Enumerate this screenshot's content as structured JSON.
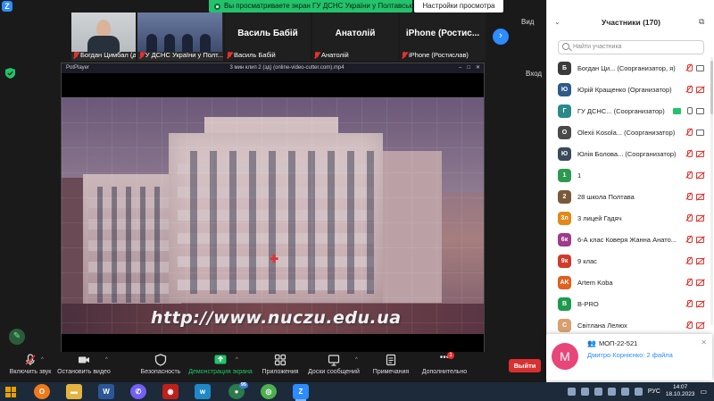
{
  "window": {
    "share_banner": "Вы просматриваете экран ГУ ДСНС України у Полтавській ...",
    "view_settings": "Настройки просмотра",
    "view_label": "Вид",
    "enter_label": "Вход"
  },
  "thumbnails": [
    {
      "name": "Богдан Цимбал (доц...",
      "type": "video"
    },
    {
      "name": "ГУ ДСНС України у Полт...",
      "type": "video"
    },
    {
      "big": "Василь Бабій",
      "name": "Василь Бабій",
      "type": "name"
    },
    {
      "big": "Анатолій",
      "name": "Анатолій",
      "type": "name"
    },
    {
      "big": "iPhone (Ростис...",
      "name": "iPhone (Ростислав)",
      "type": "name"
    }
  ],
  "player": {
    "app": "PotPlayer",
    "file": "3 мин клип 2 (зд) (online-video-cutter.com).mp4",
    "url_overlay": "http://www.nuczu.edu.ua"
  },
  "toolbar": {
    "unmute": "Включить звук",
    "stop_video": "Остановить видео",
    "security": "Безопасность",
    "screen_demo": "Демонстрация экрана",
    "apps": "Приложения",
    "messages": "Доски сообщений",
    "notes": "Примечания",
    "more": "Дополнительно",
    "more_badge": "1",
    "leave": "Выйти"
  },
  "panel": {
    "title": "Участники (170)",
    "search_placeholder": "Найти участника"
  },
  "participants": [
    {
      "initial": "Б",
      "color": "#3b3b3b",
      "name": "Богдан Ци... (Соорганизатор, я)",
      "mic": "off",
      "cam": "on",
      "badge": false
    },
    {
      "initial": "Ю",
      "color": "#2f5a8a",
      "name": "Юрій Кращенко (Организатор)",
      "mic": "off",
      "cam": "off",
      "badge": false
    },
    {
      "initial": "Г",
      "color": "#2a8a8a",
      "name": "ГУ ДСНС... (Соорганизатор)",
      "mic": "on",
      "cam": "on",
      "badge": true
    },
    {
      "initial": "O",
      "color": "#4a4a4a",
      "name": "Olexii Kosola... (Соорганизатор)",
      "mic": "off",
      "cam": "on",
      "badge": false
    },
    {
      "initial": "Ю",
      "color": "#3a4a5a",
      "name": "Юлія Болова... (Соорганизатор)",
      "mic": "off",
      "cam": "off",
      "badge": false
    },
    {
      "initial": "1",
      "color": "#2c9a4e",
      "name": "1",
      "mic": "off",
      "cam": "off",
      "badge": false
    },
    {
      "initial": "2",
      "color": "#7a5a3a",
      "name": "28 школа Полтава",
      "mic": "off",
      "cam": "off",
      "badge": false
    },
    {
      "initial": "3л",
      "color": "#e08a1a",
      "name": "3 лицей Гадяч",
      "mic": "off",
      "cam": "off",
      "badge": false
    },
    {
      "initial": "6к",
      "color": "#a03a8a",
      "name": "6-А клас Коверя Жанна Анато...",
      "mic": "off",
      "cam": "off",
      "badge": false
    },
    {
      "initial": "9к",
      "color": "#d23a2a",
      "name": "9 клас",
      "mic": "off",
      "cam": "off",
      "badge": false
    },
    {
      "initial": "AK",
      "color": "#e06020",
      "name": "Artem Koba",
      "mic": "off",
      "cam": "off",
      "badge": false
    },
    {
      "initial": "B",
      "color": "#1e9a4e",
      "name": "B-PRO",
      "mic": "off",
      "cam": "off",
      "badge": false
    },
    {
      "initial": "С",
      "color": "#d8a070",
      "name": "Світлана Лелюх",
      "mic": "off",
      "cam": "off",
      "badge": false
    }
  ],
  "notification": {
    "avatar": "M",
    "title": "МОП-22-521",
    "body": "Дмитро Корнієнко: 2 файла"
  },
  "taskbar": {
    "lang": "РУС",
    "time": "14:07",
    "date": "18.10.2023",
    "badge_95": "95"
  }
}
